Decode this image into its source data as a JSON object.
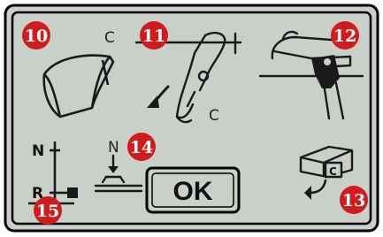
{
  "badges": {
    "b10": "10",
    "b11": "11",
    "b12": "12",
    "b13": "13",
    "b14": "14",
    "b15": "15"
  },
  "labels": {
    "c_top": "C",
    "c_hook": "C",
    "c_box": "C",
    "n_dial": "N",
    "r_dial": "R",
    "n_presser": "N"
  },
  "ok_button": {
    "label": "OK"
  },
  "colors": {
    "screen_bg": "#c9cfc9",
    "frame": "#000000",
    "badge": "#d01c1c",
    "ink": "#1a1a1a"
  }
}
